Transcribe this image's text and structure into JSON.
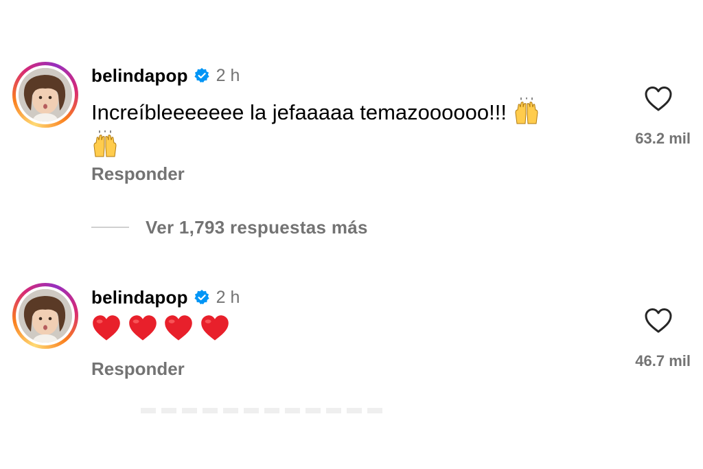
{
  "comments": [
    {
      "username": "belindapop",
      "time": "2 h",
      "text": "Increíbleeeeeee la jefaaaaa temazoooooo!!!",
      "emoji": [
        "raising-hands",
        "raising-hands"
      ],
      "reply_label": "Responder",
      "likes": "63.2 mil"
    },
    {
      "username": "belindapop",
      "time": "2 h",
      "text": "",
      "emoji": [
        "red-heart",
        "red-heart",
        "red-heart",
        "red-heart"
      ],
      "reply_label": "Responder",
      "likes": "46.7 mil"
    }
  ],
  "more_replies": {
    "label": "Ver 1,793 respuestas más"
  },
  "colors": {
    "secondary_text": "#737373",
    "verified_badge": "#0095f6",
    "heart_emoji": "#e8202b"
  },
  "icons": {
    "verified": "verified-badge-icon",
    "like": "heart-outline-icon"
  }
}
